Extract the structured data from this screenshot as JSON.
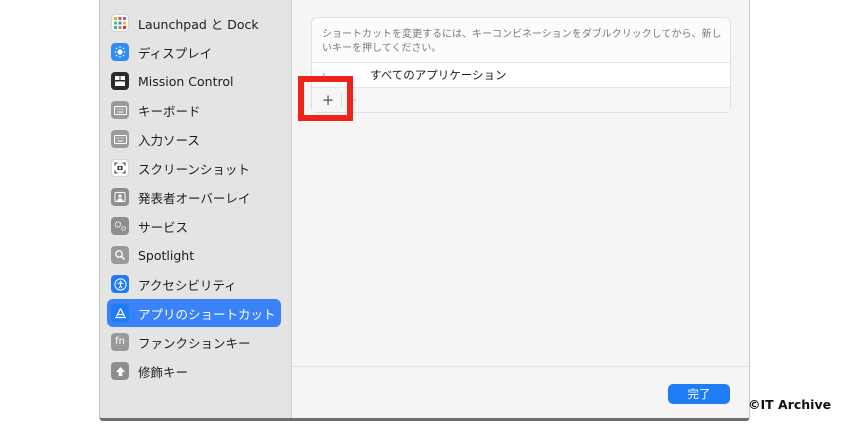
{
  "sidebar": {
    "items": [
      {
        "label": "Launchpad と Dock",
        "icon": "launchpad-icon",
        "icon_color": "#ffffff",
        "selected": false
      },
      {
        "label": "ディスプレイ",
        "icon": "display-icon",
        "icon_color": "#2f8ef6",
        "selected": false
      },
      {
        "label": "Mission Control",
        "icon": "mission-control-icon",
        "icon_color": "#2b2b2b",
        "selected": false
      },
      {
        "label": "キーボード",
        "icon": "keyboard-icon",
        "icon_color": "#9a9a9a",
        "selected": false
      },
      {
        "label": "入力ソース",
        "icon": "input-sources-icon",
        "icon_color": "#9a9a9a",
        "selected": false
      },
      {
        "label": "スクリーンショット",
        "icon": "screenshot-icon",
        "icon_color": "#ffffff",
        "selected": false
      },
      {
        "label": "発表者オーバーレイ",
        "icon": "presenter-overlay-icon",
        "icon_color": "#8e8e8e",
        "selected": false
      },
      {
        "label": "サービス",
        "icon": "services-icon",
        "icon_color": "#8e8e8e",
        "selected": false
      },
      {
        "label": "Spotlight",
        "icon": "spotlight-icon",
        "icon_color": "#9a9a9a",
        "selected": false
      },
      {
        "label": "アクセシビリティ",
        "icon": "accessibility-icon",
        "icon_color": "#1e7cf5",
        "selected": false
      },
      {
        "label": "アプリのショートカット",
        "icon": "app-shortcuts-icon",
        "icon_color": "#1e7cf5",
        "selected": true
      },
      {
        "label": "ファンクションキー",
        "icon": "fn-key-icon",
        "icon_color": "#9a9a9a",
        "selected": false
      },
      {
        "label": "修飾キー",
        "icon": "modifier-keys-icon",
        "icon_color": "#8e8e8e",
        "selected": false
      }
    ]
  },
  "panel": {
    "hint": "ショートカットを変更するには、キーコンビネーションをダブルクリックしてから、新しいキーを押してください。",
    "row_label": "すべてのアプリケーション",
    "chevron": "›",
    "add_label": "+",
    "remove_label": "−"
  },
  "footer": {
    "done_label": "完了"
  },
  "watermark": "©IT Archive",
  "colors": {
    "accent": "#1e7cf5",
    "selection": "#3a82f7",
    "highlight": "#ee2418"
  }
}
